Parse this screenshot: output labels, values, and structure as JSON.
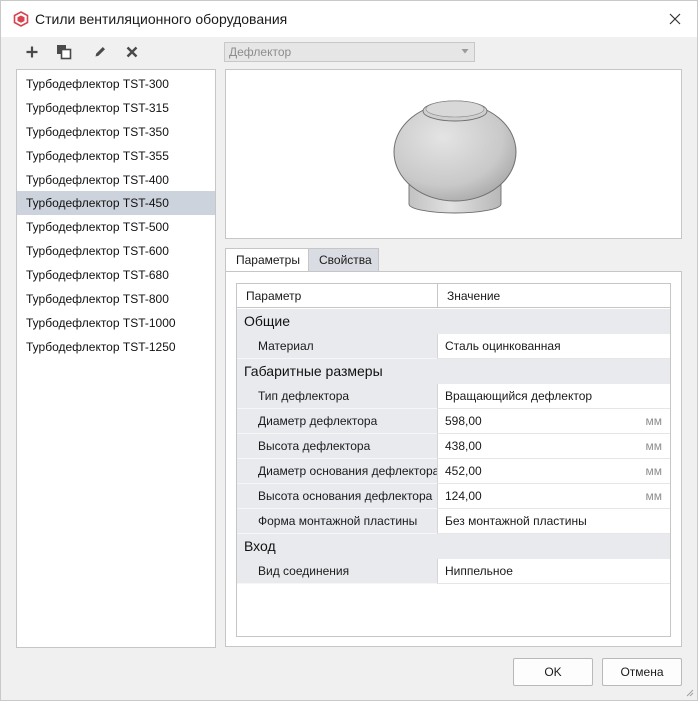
{
  "window": {
    "title": "Стили вентиляционного оборудования",
    "icons": {
      "app": "revit-app-icon",
      "close": "close-icon"
    }
  },
  "toolbar": {
    "buttons": [
      {
        "name": "add-icon"
      },
      {
        "name": "duplicate-icon"
      },
      {
        "name": "edit-icon"
      },
      {
        "name": "delete-icon"
      }
    ]
  },
  "type_select": {
    "value": "Дефлектор"
  },
  "list": {
    "items": [
      "Турбодефлектор TST-300",
      "Турбодефлектор TST-315",
      "Турбодефлектор TST-350",
      "Турбодефлектор TST-355",
      "Турбодефлектор TST-400",
      "Турбодефлектор TST-450",
      "Турбодефлектор TST-500",
      "Турбодефлектор TST-600",
      "Турбодефлектор TST-680",
      "Турбодефлектор TST-800",
      "Турбодефлектор TST-1000",
      "Турбодефлектор TST-1250"
    ],
    "selected_index": 5
  },
  "tabs": [
    {
      "label": "Параметры",
      "active": true
    },
    {
      "label": "Свойства",
      "active": false
    }
  ],
  "grid": {
    "headers": {
      "param": "Параметр",
      "value": "Значение"
    },
    "groups": [
      {
        "title": "Общие",
        "rows": [
          {
            "name": "Материал",
            "value": "Сталь оцинкованная",
            "unit": ""
          }
        ]
      },
      {
        "title": "Габаритные размеры",
        "rows": [
          {
            "name": "Тип дефлектора",
            "value": "Вращающийся дефлектор",
            "unit": ""
          },
          {
            "name": "Диаметр дефлектора",
            "value": "598,00",
            "unit": "мм"
          },
          {
            "name": "Высота дефлектора",
            "value": "438,00",
            "unit": "мм"
          },
          {
            "name": "Диаметр основания дефлектора",
            "value": "452,00",
            "unit": "мм"
          },
          {
            "name": "Высота основания дефлектора",
            "value": "124,00",
            "unit": "мм"
          },
          {
            "name": "Форма монтажной пластины",
            "value": "Без монтажной пластины",
            "unit": ""
          }
        ]
      },
      {
        "title": "Вход",
        "rows": [
          {
            "name": "Вид соединения",
            "value": "Ниппельное",
            "unit": ""
          }
        ]
      }
    ]
  },
  "buttons": {
    "ok": "OK",
    "cancel": "Отмена"
  },
  "colors": {
    "selection": "#cdd3dc",
    "group_bg": "#e8eaee",
    "app_icon": "#d9434f"
  }
}
